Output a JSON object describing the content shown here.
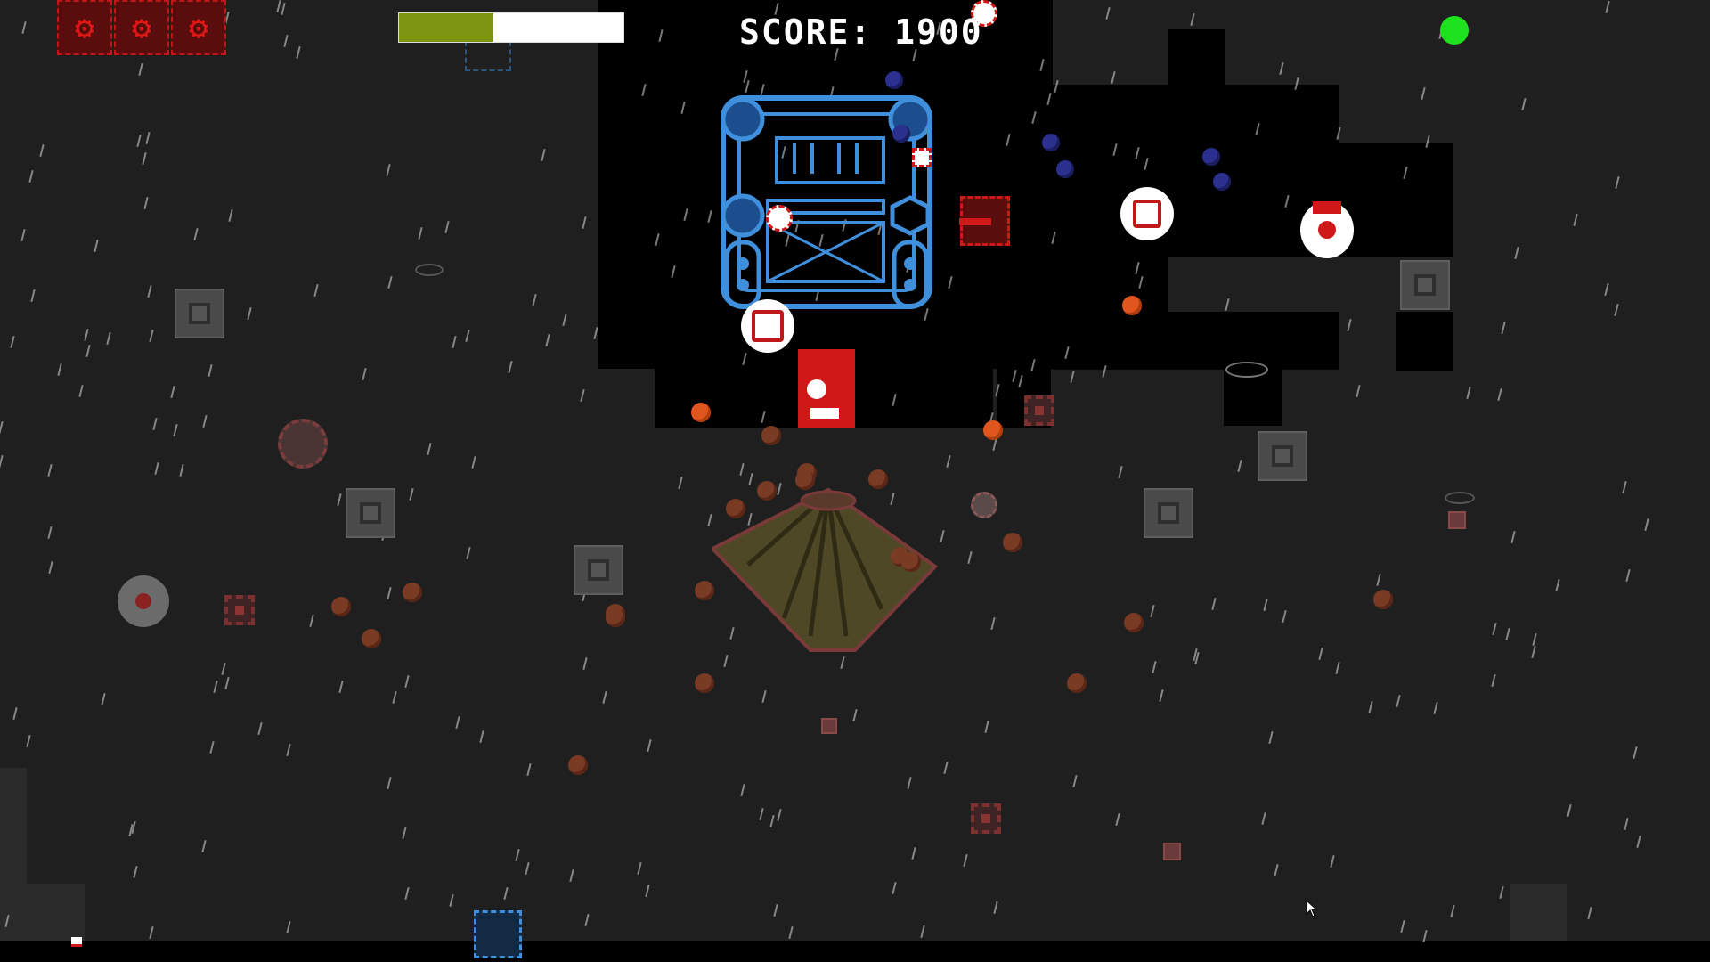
{
  "hud": {
    "score_text": "SCORE: 1900",
    "health_fraction": 0.42,
    "lives": 3,
    "life_icon": "red-cog-tank-icon",
    "status_color": "#1ee21e"
  },
  "colors": {
    "background": "#1f1f1f",
    "fog_of_war": "#000000",
    "boss_blue": "#3f8fdc",
    "enemy_red": "#d01818",
    "pellet_orange": "#e0561e",
    "health_green": "#7c9410"
  },
  "scene": {
    "weather": "rain",
    "boss": "blue-fortress-boss",
    "player": "red-tank-player",
    "volcano": "volcano-spawner"
  }
}
